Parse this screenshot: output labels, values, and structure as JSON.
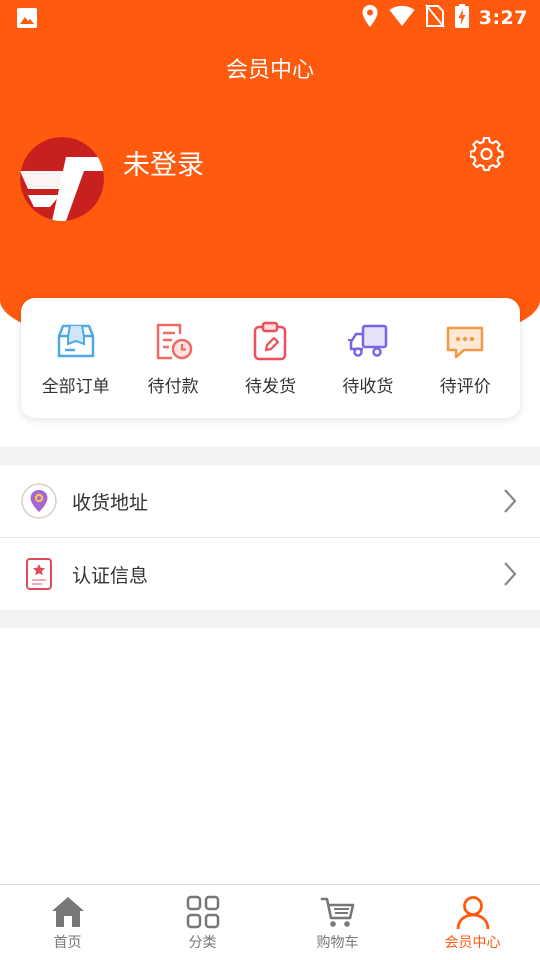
{
  "status_bar": {
    "time": "3:27"
  },
  "page": {
    "title": "会员中心"
  },
  "profile": {
    "username": "未登录"
  },
  "orders": [
    {
      "label": "全部订单",
      "icon": "box-icon"
    },
    {
      "label": "待付款",
      "icon": "bill-clock-icon"
    },
    {
      "label": "待发货",
      "icon": "clipboard-pen-icon"
    },
    {
      "label": "待收货",
      "icon": "truck-icon"
    },
    {
      "label": "待评价",
      "icon": "chat-bubble-icon"
    }
  ],
  "menu": [
    {
      "label": "收货地址",
      "icon": "location-pin-icon"
    },
    {
      "label": "认证信息",
      "icon": "certificate-icon"
    }
  ],
  "tabbar": [
    {
      "label": "首页",
      "icon": "home-icon"
    },
    {
      "label": "分类",
      "icon": "grid-icon"
    },
    {
      "label": "购物车",
      "icon": "cart-icon"
    },
    {
      "label": "会员中心",
      "icon": "user-icon"
    }
  ],
  "colors": {
    "brand": "#ff5a0e",
    "tab_inactive": "#777777",
    "tab_active": "#ff5a0e"
  }
}
